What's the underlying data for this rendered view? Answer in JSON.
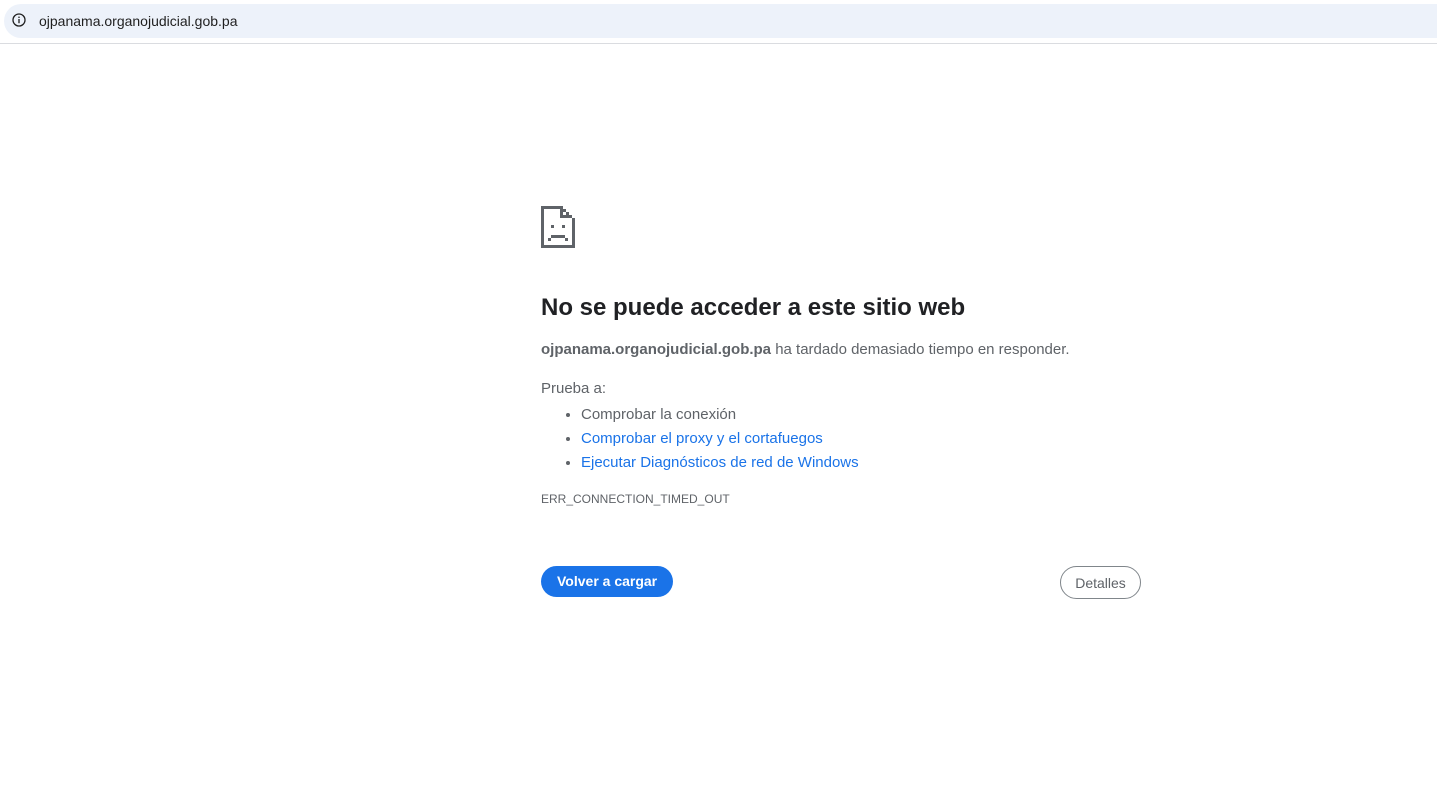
{
  "browser": {
    "url": "ojpanama.organojudicial.gob.pa",
    "site_info_icon": "info-icon"
  },
  "error_page": {
    "icon": "sad-document-icon",
    "headline": "No se puede acceder a este sitio web",
    "host": "ojpanama.organojudicial.gob.pa",
    "summary_rest": " ha tardado demasiado tiempo en responder.",
    "suggestions_heading": "Prueba a:",
    "suggestions": [
      {
        "label": "Comprobar la conexión",
        "is_link": false
      },
      {
        "label": "Comprobar el proxy y el cortafuegos",
        "is_link": true
      },
      {
        "label": "Ejecutar Diagnósticos de red de Windows",
        "is_link": true
      }
    ],
    "error_code": "ERR_CONNECTION_TIMED_OUT",
    "reload_label": "Volver a cargar",
    "details_label": "Detalles"
  },
  "colors": {
    "accent": "#1a73e8",
    "text": "#5f6368",
    "heading": "#202124",
    "omnibox_bg": "#edf2fa"
  }
}
